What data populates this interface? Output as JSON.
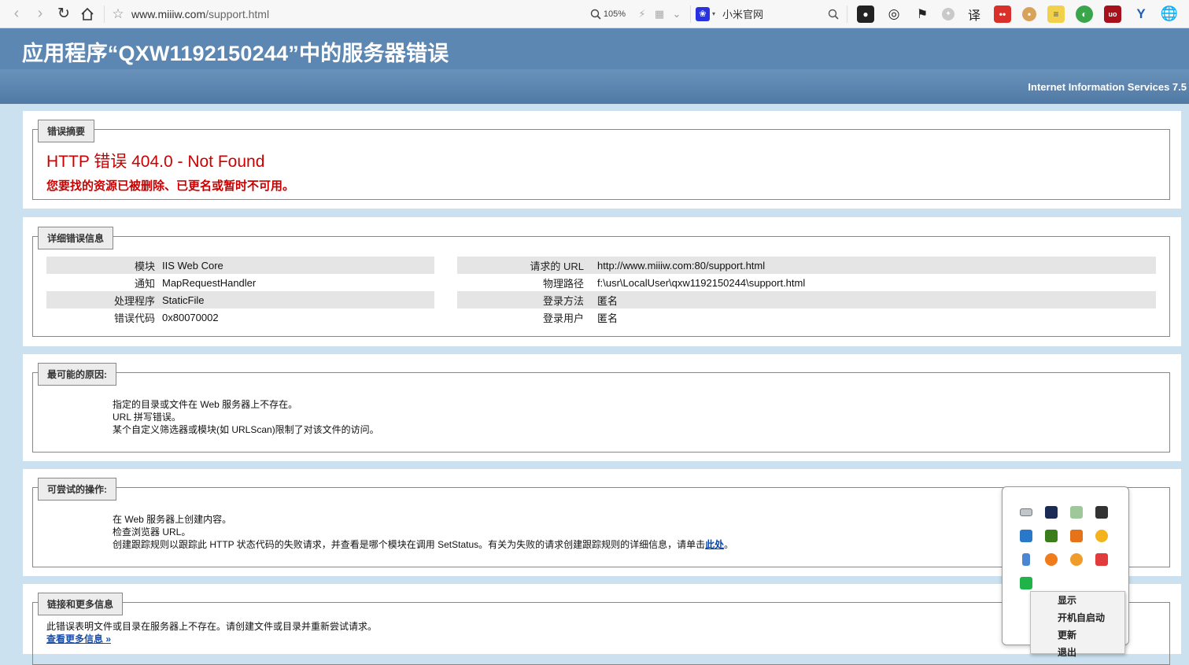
{
  "browser": {
    "url_main": "www.miiiw.com",
    "url_path": "/support.html",
    "zoom": "105%",
    "search_text": "小米官网",
    "translate_label": "译"
  },
  "page": {
    "title": "应用程序“QXW1192150244”中的服务器错误",
    "server": "Internet Information Services 7.5"
  },
  "summary": {
    "legend": "错误摘要",
    "error": "HTTP 错误 404.0 - Not Found",
    "message": "您要找的资源已被删除、已更名或暂时不可用。"
  },
  "details": {
    "legend": "详细错误信息",
    "left": [
      {
        "label": "模块",
        "value": "IIS Web Core"
      },
      {
        "label": "通知",
        "value": "MapRequestHandler"
      },
      {
        "label": "处理程序",
        "value": "StaticFile"
      },
      {
        "label": "错误代码",
        "value": "0x80070002"
      }
    ],
    "right": [
      {
        "label": "请求的 URL",
        "value": "http://www.miiiw.com:80/support.html"
      },
      {
        "label": "物理路径",
        "value": "f:\\usr\\LocalUser\\qxw1192150244\\support.html"
      },
      {
        "label": "登录方法",
        "value": "匿名"
      },
      {
        "label": "登录用户",
        "value": "匿名"
      }
    ]
  },
  "causes": {
    "legend": "最可能的原因:",
    "items": [
      "指定的目录或文件在 Web 服务器上不存在。",
      "URL 拼写错误。",
      "某个自定义筛选器或模块(如 URLScan)限制了对该文件的访问。"
    ]
  },
  "actions": {
    "legend": "可尝试的操作:",
    "items": [
      "在 Web 服务器上创建内容。",
      "检查浏览器 URL。"
    ],
    "trace_text": "创建跟踪规则以跟踪此 HTTP 状态代码的失败请求，并查看是哪个模块在调用 SetStatus。有关为失败的请求创建跟踪规则的详细信息，请单击",
    "trace_link": "此处",
    "trace_end": "。"
  },
  "links": {
    "legend": "链接和更多信息",
    "text": "此错误表明文件或目录在服务器上不存在。请创建文件或目录并重新尝试请求。",
    "link": "查看更多信息 »"
  },
  "context_menu": {
    "items": [
      "显示",
      "开机自启动",
      "更新",
      "退出"
    ]
  },
  "tray_icons": [
    "drive-icon",
    "monitor-icon",
    "check-drive-icon",
    "film-icon",
    "display-icon",
    "nvidia-icon",
    "orange-app-icon",
    "flame-icon",
    "usb-icon",
    "gear-app-icon",
    "circle-app-icon",
    "red-app-icon",
    "green-app-icon"
  ],
  "colors": {
    "header_blue": "#5c87b2",
    "error_red": "#cc0000",
    "page_bg": "#cbe1ef"
  }
}
